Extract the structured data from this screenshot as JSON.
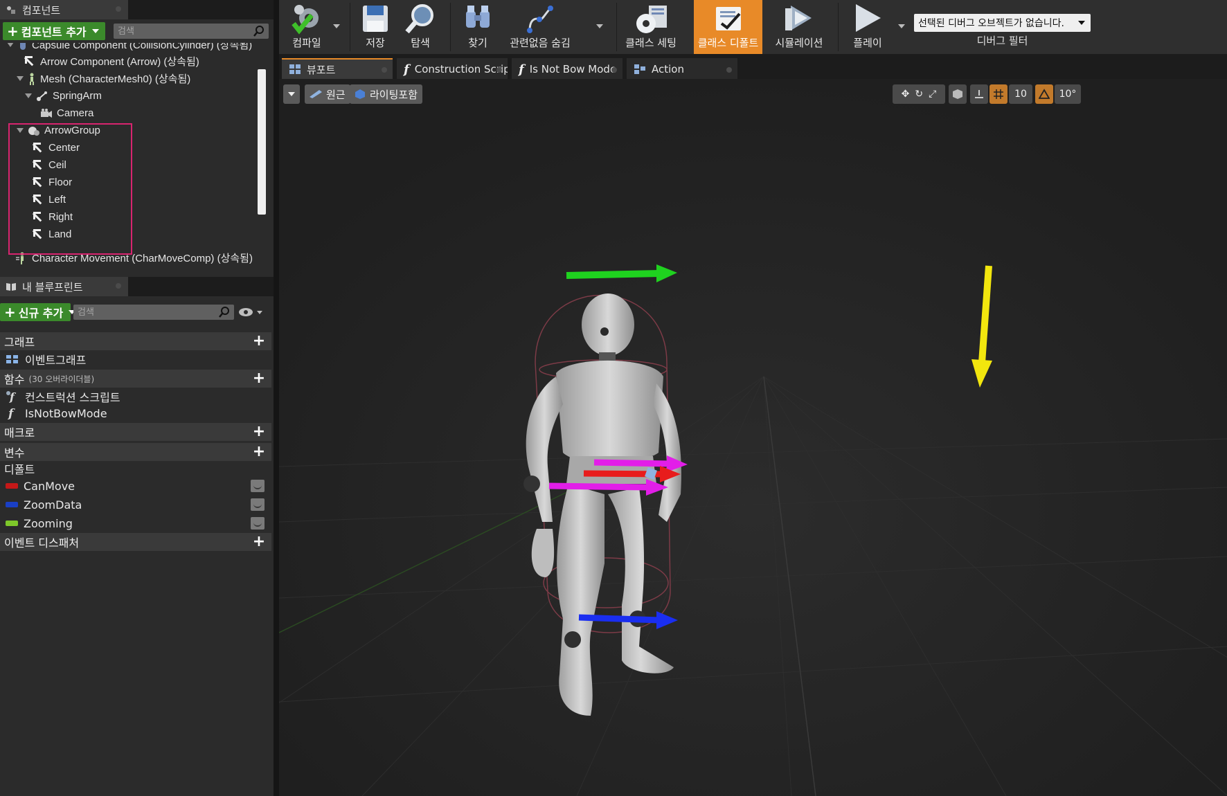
{
  "components_panel": {
    "tab_label": "컴포넌트",
    "add_button": "컴포넌트 추가",
    "search_placeholder": "검색",
    "tree": [
      "Capsule Component (CollisionCylinder) (상속됨)",
      "Arrow Component (Arrow) (상속됨)",
      "Mesh (CharacterMesh0) (상속됨)",
      "SpringArm",
      "Camera",
      "ArrowGroup",
      "Center",
      "Ceil",
      "Floor",
      "Left",
      "Right",
      "Land",
      "Character Movement (CharMoveComp) (상속됨)"
    ]
  },
  "blueprint_panel": {
    "tab_label": "내 블루프린트",
    "add_button": "신규 추가",
    "search_placeholder": "검색",
    "sections": {
      "graph": "그래프",
      "event_graph": "이벤트그래프",
      "functions": "함수",
      "functions_note": "(30 오버라이더블)",
      "construction_script": "컨스트럭션 스크립트",
      "is_not_bow_mode": "IsNotBowMode",
      "macros": "매크로",
      "variables": "변수",
      "default_category": "디폴트",
      "event_dispatchers": "이벤트 디스패처"
    },
    "variables": [
      {
        "name": "CanMove",
        "color": "#c41818"
      },
      {
        "name": "ZoomData",
        "color": "#1a3fc4"
      },
      {
        "name": "Zooming",
        "color": "#7ec82a"
      }
    ]
  },
  "toolbar": {
    "compile": "컴파일",
    "save": "저장",
    "browse": "탐색",
    "find": "찾기",
    "hide_unrelated": "관련없음 숨김",
    "class_settings": "클래스 세팅",
    "class_defaults": "클래스 디폴트",
    "simulation": "시뮬레이션",
    "play": "플레이",
    "debug_select": "선택된 디버그 오브젝트가 없습니다.",
    "debug_filter": "디버그 필터",
    "accent": "#e88a28"
  },
  "editor_tabs": [
    "뷰포트",
    "Construction Scrip",
    "Is Not Bow Mode",
    "Action"
  ],
  "viewport": {
    "perspective_btn": "원근",
    "lighting_btn": "라이팅포함",
    "grid_size": "10",
    "rotation_snap": "10°"
  }
}
